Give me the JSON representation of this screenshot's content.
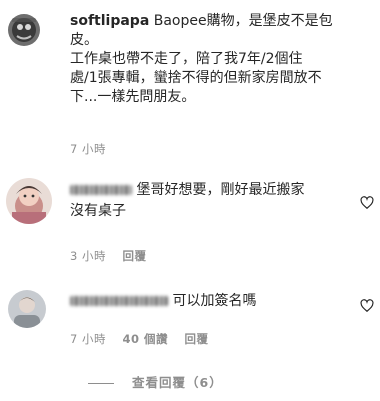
{
  "comments": [
    {
      "username": "softlipapa",
      "line1": "Baopee購物，是堡皮不是包",
      "line2": "皮。",
      "para2_line1": "工作桌也帶不走了，陪了我7年/2個住",
      "para2_line2": "處/1張專輯，蠻捨不得的但新家房間放不",
      "para2_line3": "下...一樣先問朋友。",
      "time": "7 小時"
    },
    {
      "username_blurred": true,
      "line1": "堡哥好想要，剛好最近搬家",
      "line2": "沒有桌子",
      "time": "3 小時",
      "reply_label": "回覆"
    },
    {
      "username_blurred": true,
      "line1": "可以加簽名嗎",
      "time": "7 小時",
      "likes": "40 個讚",
      "reply_label": "回覆"
    }
  ],
  "view_replies": "查看回覆（6）",
  "icons": {
    "like": "heart-outline-icon"
  },
  "colors": {
    "text": "#262626",
    "meta": "#8e8e8e"
  }
}
